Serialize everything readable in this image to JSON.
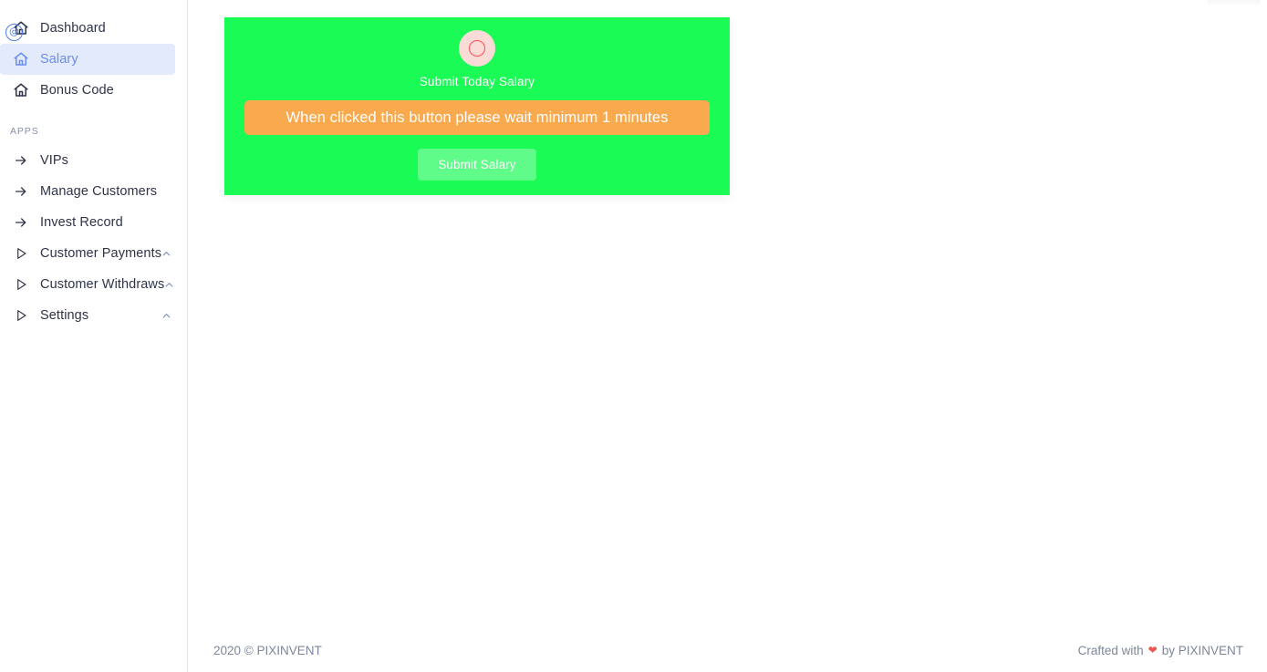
{
  "sidebar": {
    "brand_icon": "home-brand-icon",
    "primary_items": [
      {
        "label": "Dashboard",
        "icon": "home-icon",
        "active": false
      },
      {
        "label": "Salary",
        "icon": "home-icon",
        "active": true
      },
      {
        "label": "Bonus Code",
        "icon": "home-icon",
        "active": false
      }
    ],
    "section_label": "APPS",
    "app_items": [
      {
        "label": "VIPs",
        "icon": "arrow-right-icon",
        "expandable": false
      },
      {
        "label": "Manage Customers",
        "icon": "arrow-right-icon",
        "expandable": false
      },
      {
        "label": "Invest Record",
        "icon": "arrow-right-icon",
        "expandable": false
      },
      {
        "label": "Customer Payments",
        "icon": "play-triangle-icon",
        "expandable": true,
        "chevron": "chevron-up-icon"
      },
      {
        "label": "Customer Withdraws",
        "icon": "play-triangle-icon",
        "expandable": true,
        "chevron": "chevron-up-icon"
      },
      {
        "label": "Settings",
        "icon": "play-triangle-icon",
        "expandable": true,
        "chevron": "chevron-up-icon"
      }
    ]
  },
  "salary_card": {
    "avatar_icon": "circle-outline-icon",
    "subtitle": "Submit Today Salary",
    "warning_label": "When clicked this button please wait minimum 1 minutes",
    "submit_label": "Submit Salary"
  },
  "footer": {
    "copyright": "2020 © PIXINVENT",
    "crafted_prefix": "Crafted with",
    "heart_icon": "heart-icon",
    "crafted_suffix": "by PIXINVENT"
  },
  "colors": {
    "card_green": "#1afb56",
    "warning_orange": "#f9a94e",
    "accent_blue": "#6a8dee",
    "active_bg": "#e3eafc",
    "avatar_pink": "#fbdbd8",
    "avatar_ring_red": "#ef5350",
    "text_dark": "#2f3349",
    "text_muted": "#7d869c"
  }
}
